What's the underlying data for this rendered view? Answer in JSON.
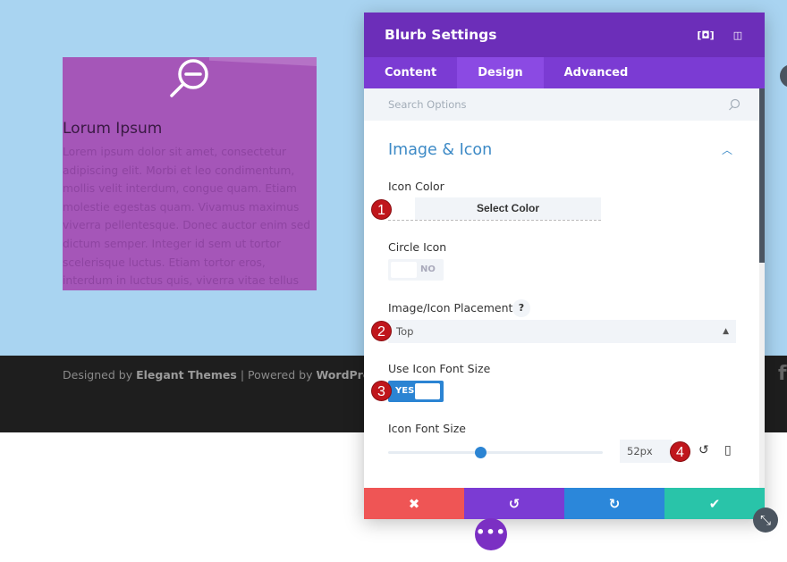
{
  "blurb": {
    "title": "Lorum Ipsum",
    "text": "Lorem ipsum dolor sit amet, consectetur adipiscing elit. Morbi et leo condimentum, mollis velit interdum, congue quam. Etiam molestie egestas quam. Vivamus maximus viverra pellentesque. Donec auctor enim sed dictum semper. Integer id sem ut tortor scelerisque luctus. Etiam tortor eros, interdum in luctus quis, viverra vitae tellus",
    "icon": "zoom-out-icon",
    "background": "#a556b8"
  },
  "footer": {
    "designed_by": "Designed by",
    "designer": "Elegant Themes",
    "separator": "|",
    "powered_by": "Powered by",
    "platform": "WordPress",
    "social_icon": "facebook-icon"
  },
  "modal": {
    "title": "Blurb Settings",
    "tabs": [
      {
        "label": "Content"
      },
      {
        "label": "Design",
        "active": true
      },
      {
        "label": "Advanced"
      }
    ],
    "search_placeholder": "Search Options",
    "section_title": "Image & Icon",
    "icon_color_label": "Icon Color",
    "select_color_label": "Select Color",
    "circle_icon_label": "Circle Icon",
    "circle_icon_value": "NO",
    "placement_label": "Image/Icon Placement",
    "placement_help": "?",
    "placement_value": "Top",
    "use_icon_font_size_label": "Use Icon Font Size",
    "use_icon_font_size_value": "YES",
    "icon_font_size_label": "Icon Font Size",
    "icon_font_size_value": "52px",
    "slider_percent": 43,
    "badges": [
      "1",
      "2",
      "3",
      "4"
    ],
    "actions": {
      "cancel": "✖",
      "undo": "↺",
      "redo": "↻",
      "save": "✔"
    },
    "colors": {
      "header": "#6c2eb9",
      "tabs": "#7b3bd3",
      "cancel": "#ef5555",
      "undo": "#7b3bd3",
      "redo": "#2b87da",
      "save": "#29c4a9"
    }
  },
  "fab": {
    "more": "•••",
    "resize": "⤡"
  }
}
